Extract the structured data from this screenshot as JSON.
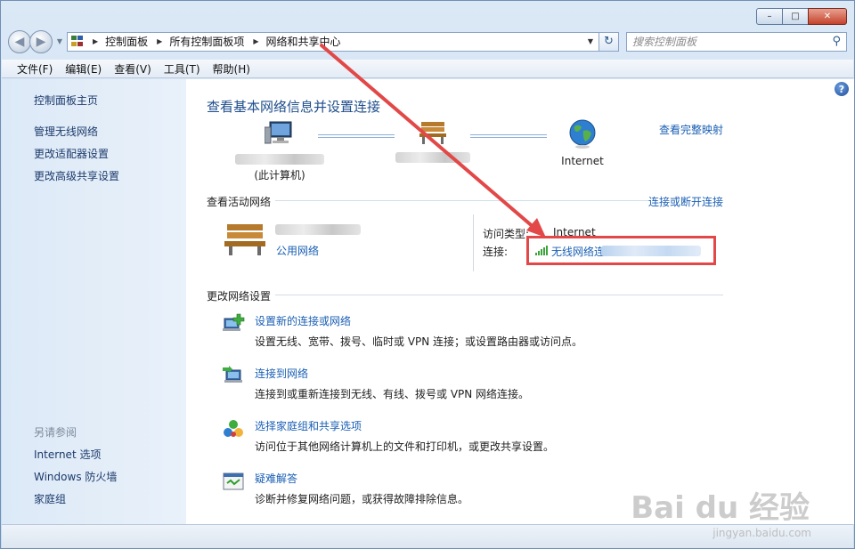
{
  "window": {
    "caption_buttons": {
      "minimize": "–",
      "maximize": "□",
      "close": "✕"
    }
  },
  "addressbar": {
    "crumbs": [
      "控制面板",
      "所有控制面板项",
      "网络和共享中心"
    ],
    "search_placeholder": "搜索控制面板"
  },
  "menu": [
    "文件(F)",
    "编辑(E)",
    "查看(V)",
    "工具(T)",
    "帮助(H)"
  ],
  "sidebar": {
    "links": [
      "控制面板主页",
      "管理无线网络",
      "更改适配器设置",
      "更改高级共享设置"
    ],
    "see_also_label": "另请参阅",
    "see_also": [
      "Internet 选项",
      "Windows 防火墙",
      "家庭组"
    ]
  },
  "content": {
    "title": "查看基本网络信息并设置连接",
    "full_map": "查看完整映射",
    "map": {
      "this_computer": "(此计算机)",
      "internet": "Internet"
    },
    "active_label": "查看活动网络",
    "connect_disconnect": "连接或断开连接",
    "network": {
      "type": "公用网络"
    },
    "access_type_label": "访问类型:",
    "access_type_value": "Internet",
    "connection_label": "连接:",
    "connection_value": "无线网络连"
  },
  "change_settings": {
    "label": "更改网络设置",
    "tasks": [
      {
        "title": "设置新的连接或网络",
        "desc": "设置无线、宽带、拨号、临时或 VPN 连接；或设置路由器或访问点。"
      },
      {
        "title": "连接到网络",
        "desc": "连接到或重新连接到无线、有线、拨号或 VPN 网络连接。"
      },
      {
        "title": "选择家庭组和共享选项",
        "desc": "访问位于其他网络计算机上的文件和打印机，或更改共享设置。"
      },
      {
        "title": "疑难解答",
        "desc": "诊断并修复网络问题，或获得故障排除信息。"
      }
    ]
  },
  "watermark": {
    "main": "Bai du 经验",
    "sub": "jingyan.baidu.com"
  },
  "colors": {
    "link": "#1a5fb4",
    "highlight_box": "#e24848",
    "arrow": "#e24848"
  }
}
